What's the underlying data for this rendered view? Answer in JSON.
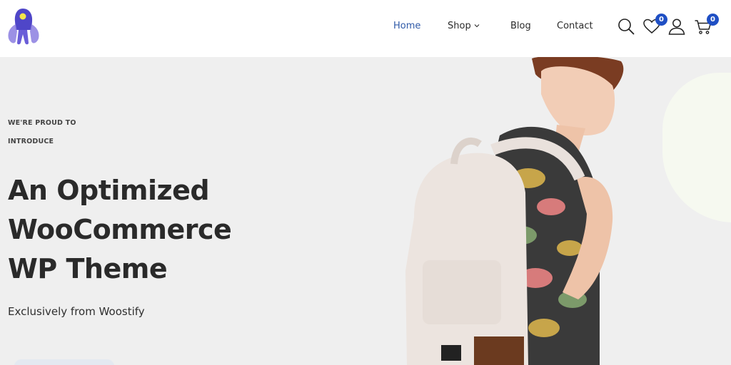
{
  "header": {
    "logo": {
      "icon": "rocket-logo-icon",
      "color": "#5b4fd0"
    },
    "nav": [
      {
        "label": "Home",
        "active": true
      },
      {
        "label": "Shop",
        "has_dropdown": true
      },
      {
        "label": "Blog"
      },
      {
        "label": "Contact"
      }
    ],
    "icons": {
      "search": "search-icon",
      "wishlist": "heart-icon",
      "account": "user-icon",
      "cart": "cart-icon"
    },
    "wishlist_count": "0",
    "cart_count": "0",
    "colors": {
      "active_link": "#2f5aa8",
      "badge": "#1f4fc4"
    }
  },
  "hero": {
    "eyebrow_line1": "WE'RE PROUD TO",
    "eyebrow_line2": "INTRODUCE",
    "headline_line1": "An Optimized",
    "headline_line2": "WooCommerce",
    "headline_line3": "WP Theme",
    "subheading": "Exclusively from Woostify",
    "background_color": "#efefef"
  }
}
